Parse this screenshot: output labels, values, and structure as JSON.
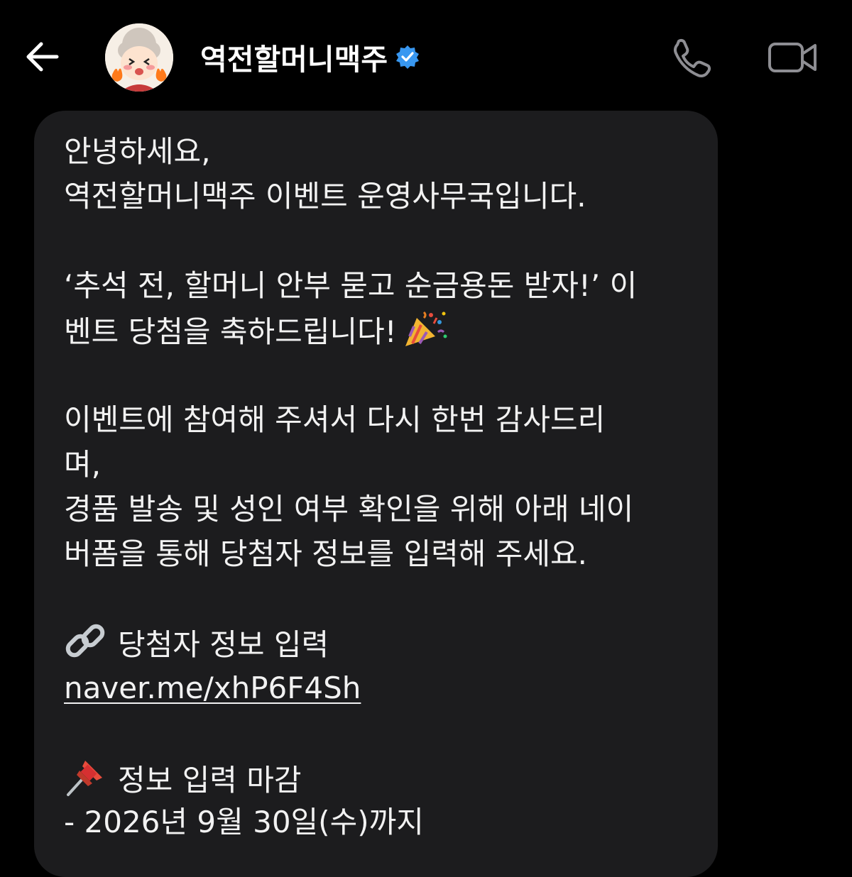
{
  "header": {
    "title": "역전할머니맥주",
    "verified": true,
    "icons": {
      "back": "back-arrow-icon",
      "call": "phone-icon",
      "video": "video-camera-icon",
      "badge": "verified-badge-icon"
    }
  },
  "message": {
    "greeting_1": "안녕하세요,",
    "greeting_2": "역전할머니맥주 이벤트 운영사무국입니다.",
    "event_1": "‘추석 전, 할머니 안부 묻고 순금용돈 받자!’ 이",
    "event_2": "벤트 당첨을 축하드립니다!",
    "body_1": "이벤트에 참여해 주셔서 다시 한번 감사드리",
    "body_2": "며,",
    "body_3": "경품 발송 및 성인 여부 확인을 위해 아래 네이",
    "body_4": "버폼을 통해 당첨자 정보를 입력해 주세요.",
    "link_heading": "당첨자 정보 입력",
    "link_url": "naver.me/xhP6F4Sh",
    "deadline_heading": "정보 입력 마감",
    "deadline_value": "- 2026년 9월 30일(수)까지",
    "emojis": [
      "party-popper-icon",
      "link-chain-icon",
      "pushpin-icon"
    ]
  },
  "colors": {
    "background": "#000000",
    "bubble": "#1c1c1e",
    "text": "#f2f2f2",
    "icon_gray": "#8e8e93",
    "verified_blue": "#3897f0"
  }
}
